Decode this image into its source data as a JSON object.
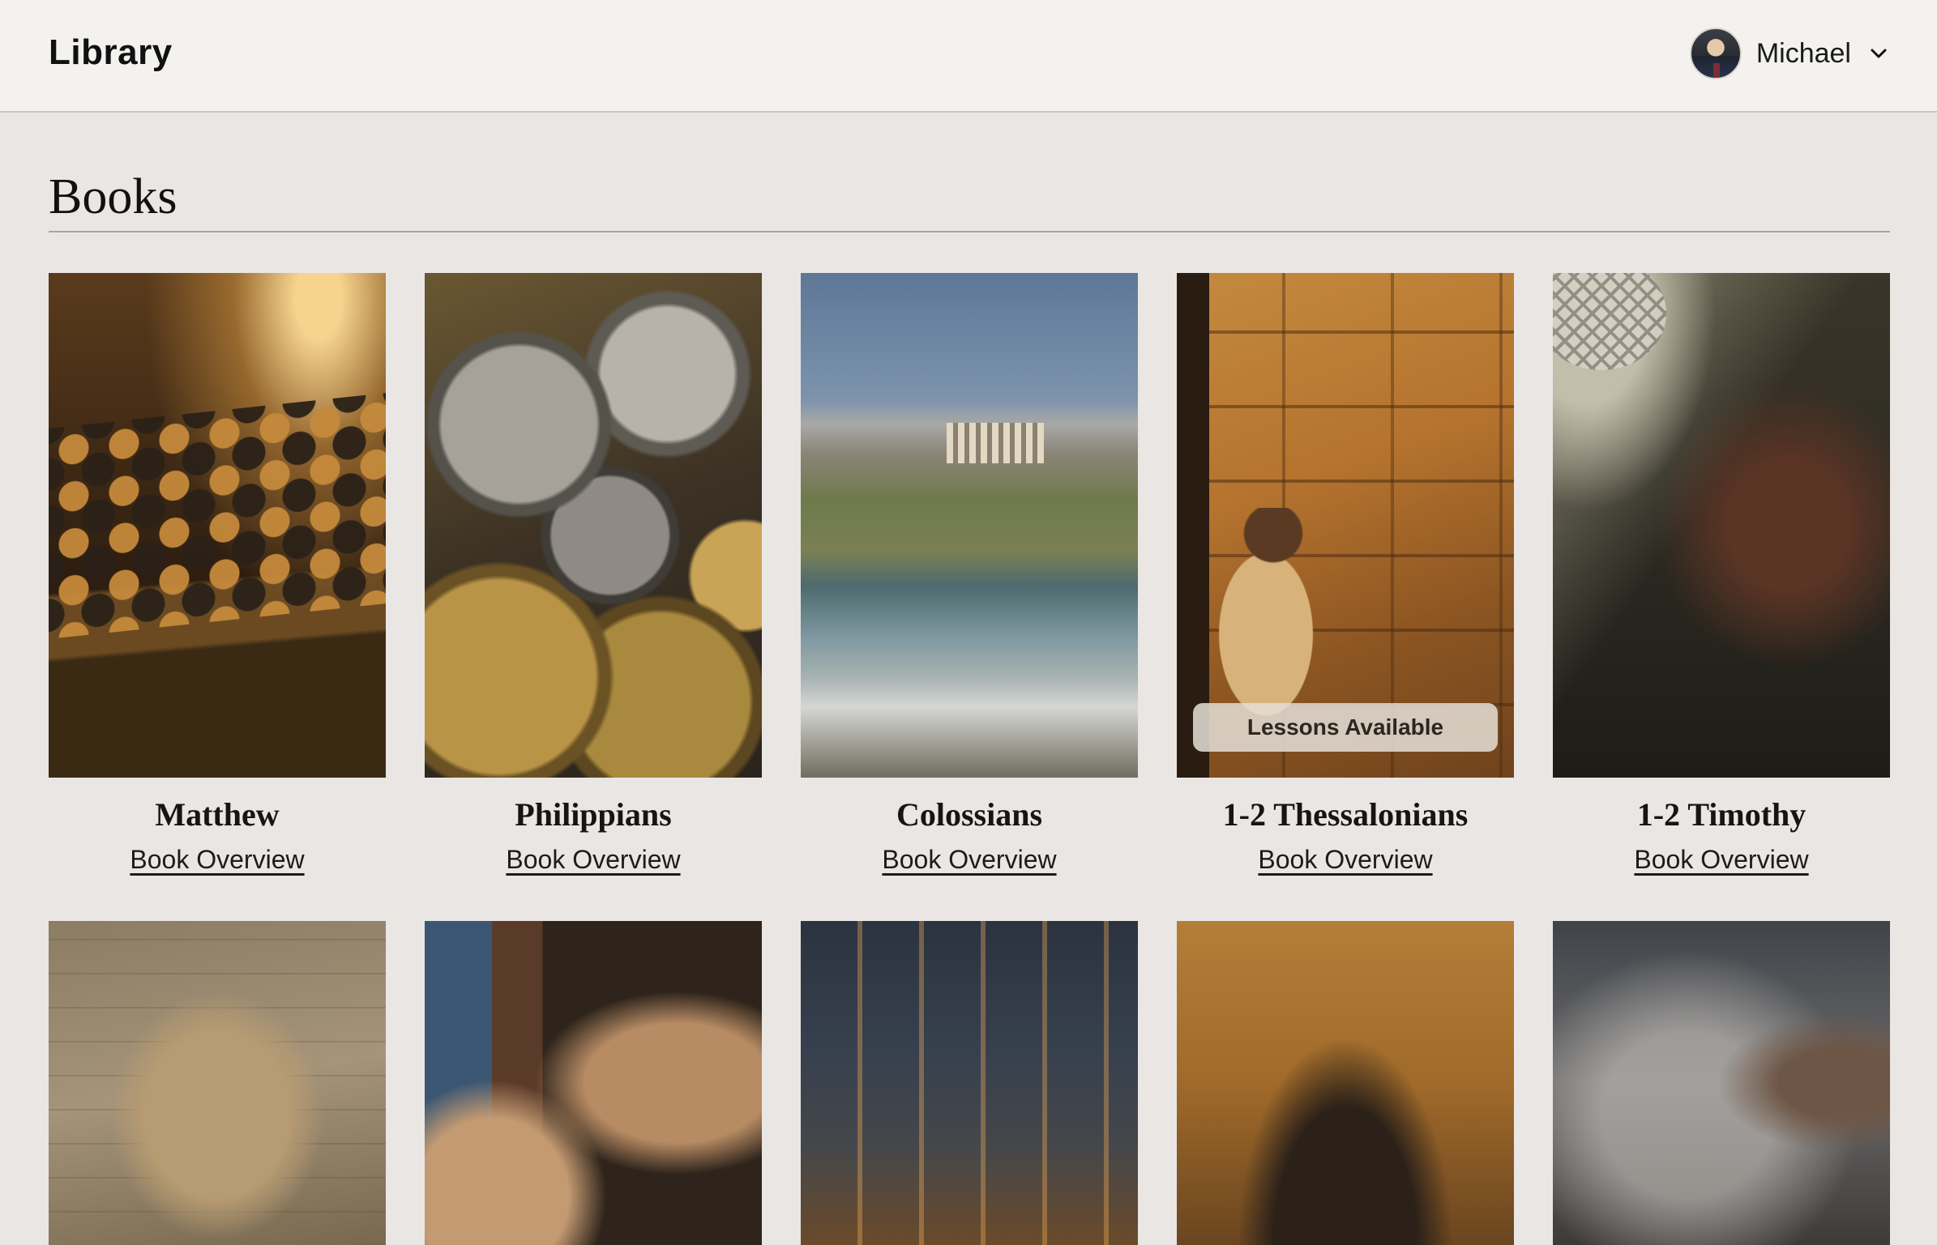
{
  "header": {
    "app_title": "Library",
    "user": {
      "name": "Michael"
    }
  },
  "section": {
    "title": "Books"
  },
  "books_row1": [
    {
      "title": "Matthew",
      "link": "Book Overview",
      "badge": ""
    },
    {
      "title": "Philippians",
      "link": "Book Overview",
      "badge": ""
    },
    {
      "title": "Colossians",
      "link": "Book Overview",
      "badge": ""
    },
    {
      "title": "1-2 Thessalonians",
      "link": "Book Overview",
      "badge": "Lessons Available"
    },
    {
      "title": "1-2 Timothy",
      "link": "Book Overview",
      "badge": ""
    }
  ],
  "colors": {
    "page_background": "#e9e6e4",
    "header_background": "#f4f2ef",
    "text": "#111111"
  }
}
